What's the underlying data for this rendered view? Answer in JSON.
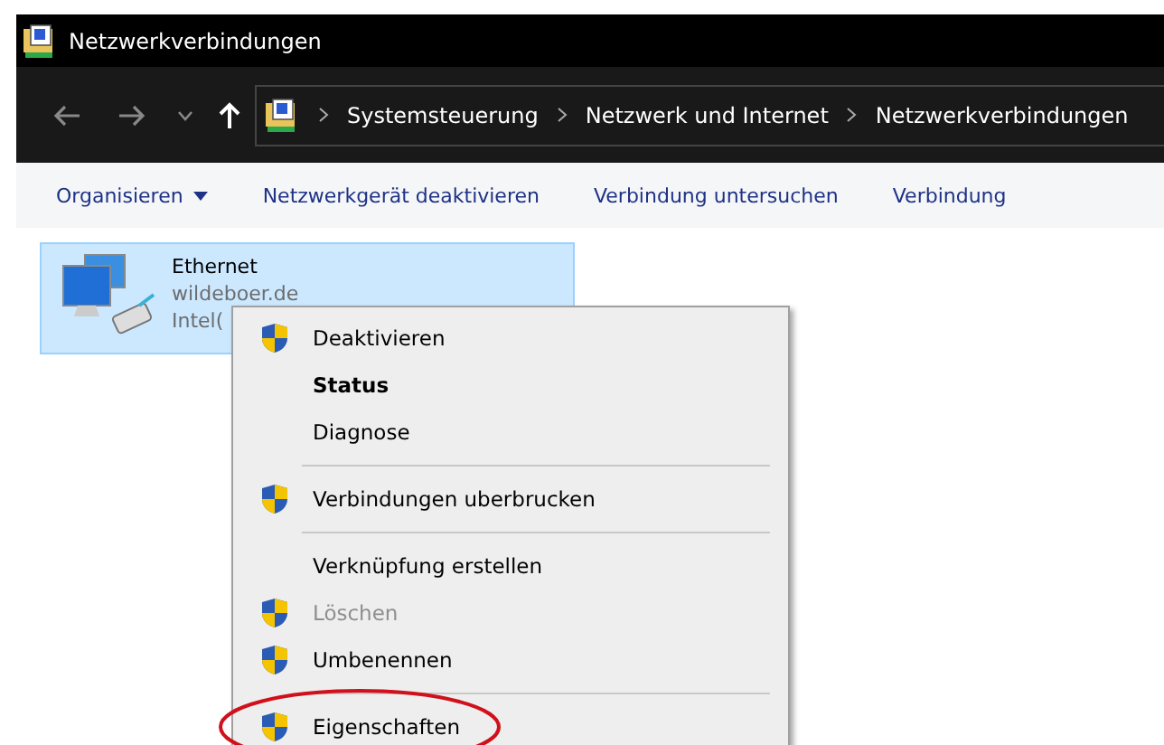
{
  "window": {
    "title": "Netzwerkverbindungen"
  },
  "breadcrumb": [
    "Systemsteuerung",
    "Netzwerk und Internet",
    "Netzwerkverbindungen"
  ],
  "toolbar": [
    {
      "label": "Organisieren",
      "dropdown": true
    },
    {
      "label": "Netzwerkgerät deaktivieren",
      "dropdown": false
    },
    {
      "label": "Verbindung untersuchen",
      "dropdown": false
    },
    {
      "label": "Verbindung",
      "dropdown": false
    }
  ],
  "connection": {
    "name": "Ethernet",
    "domain": "wildeboer.de",
    "adapter": "Intel(",
    "selected": true
  },
  "context_menu": [
    {
      "kind": "item",
      "label": "Deaktivieren",
      "shield": true,
      "bold": false,
      "disabled": false,
      "circled": false
    },
    {
      "kind": "item",
      "label": "Status",
      "shield": false,
      "bold": true,
      "disabled": false,
      "circled": false
    },
    {
      "kind": "item",
      "label": "Diagnose",
      "shield": false,
      "bold": false,
      "disabled": false,
      "circled": false
    },
    {
      "kind": "separator"
    },
    {
      "kind": "item",
      "label": "Verbindungen uberbrucken",
      "shield": true,
      "bold": false,
      "disabled": false,
      "circled": false
    },
    {
      "kind": "separator"
    },
    {
      "kind": "item",
      "label": "Verknüpfung erstellen",
      "shield": false,
      "bold": false,
      "disabled": false,
      "circled": false
    },
    {
      "kind": "item",
      "label": "Löschen",
      "shield": true,
      "bold": false,
      "disabled": true,
      "circled": false
    },
    {
      "kind": "item",
      "label": "Umbenennen",
      "shield": true,
      "bold": false,
      "disabled": false,
      "circled": false
    },
    {
      "kind": "separator"
    },
    {
      "kind": "item",
      "label": "Eigenschaften",
      "shield": true,
      "bold": false,
      "disabled": false,
      "circled": true
    }
  ]
}
